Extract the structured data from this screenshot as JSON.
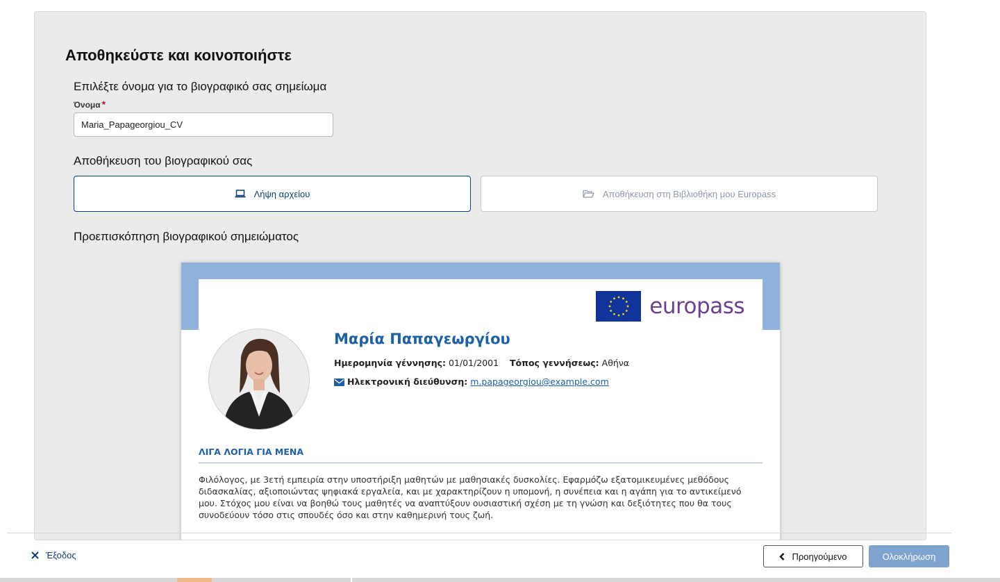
{
  "page": {
    "title": "Αποθηκεύστε και κοινοποιήστε"
  },
  "name_section": {
    "heading": "Επιλέξτε όνομα για το βιογραφικό σας σημείωμα",
    "field_label": "Όνομα",
    "required_mark": "*",
    "value": "Maria_Papageorgiou_CV"
  },
  "save_section": {
    "heading": "Αποθήκευση του βιογραφικού σας",
    "download_label": "Λήψη αρχείου",
    "download_icon": "laptop-icon",
    "library_label": "Αποθήκευση στη Βιβλιοθήκη μου Europass",
    "library_icon": "folder-open-icon"
  },
  "preview": {
    "heading": "Προεπισκόπηση βιογραφικού σημειώματος",
    "logo_text": "europass",
    "name": "Μαρία Παπαγεωργίου",
    "birth_date_label": "Ημερομηνία γέννησης:",
    "birth_date": "01/01/2001",
    "birth_place_label": "Τόπος γεννήσεως:",
    "birth_place": "Αθήνα",
    "email_label": "Ηλεκτρονική διεύθυνση:",
    "email": "m.papageorgiou@example.com",
    "about_heading": "ΛΙΓΑ ΛΟΓΙΑ ΓΙΑ ΜΕΝΑ",
    "about_text": "Φιλόλογος, με 3ετή εμπειρία στην υποστήριξη μαθητών με μαθησιακές δυσκολίες. Εφαρμόζω εξατομικευμένες μεθόδους διδασκαλίας, αξιοποιώντας ψηφιακά εργαλεία, και με χαρακτηρίζουν η υπομονή, η συνέπεια και η αγάπη για το αντικείμενό μου. Στόχος μου είναι να βοηθώ τους μαθητές να αναπτύξουν ουσιαστική σχέση με τη γνώση και δεξιότητες που θα τους συνοδεύουν τόσο στις σπουδές όσο και στην καθημερινή τους ζωή."
  },
  "footer": {
    "exit_label": "Έξοδος",
    "prev_label": "Προηγούμενο",
    "finish_label": "Ολοκλήρωση"
  },
  "colors": {
    "primary": "#0e3d75",
    "cv_blue": "#1e5fa9",
    "cv_band": "#8fb2dc",
    "europass_purple": "#6b3f91",
    "eu_flag_blue": "#12349a",
    "finish_button": "#7ea3cf"
  }
}
